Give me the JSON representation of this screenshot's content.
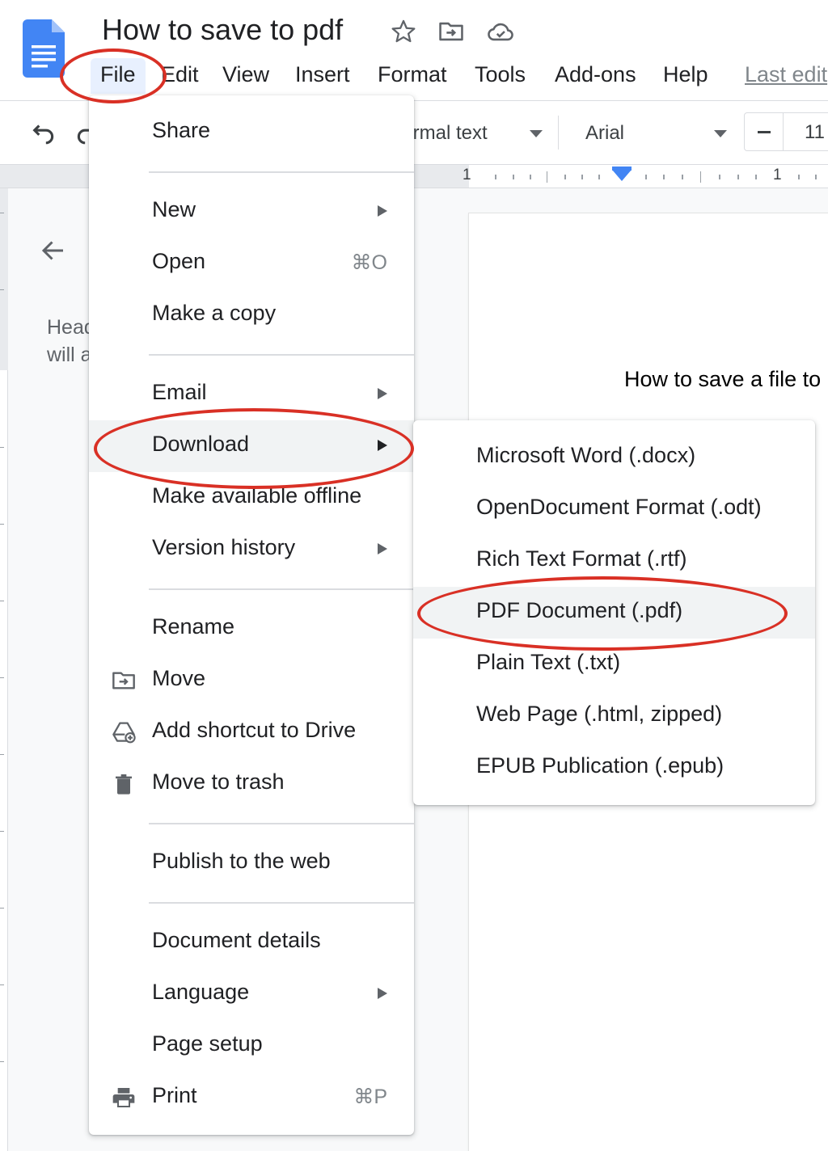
{
  "app": {
    "doc_title": "How to save to pdf",
    "accent": "#4285f4",
    "annotation_color": "#d93025"
  },
  "menubar": {
    "items": [
      "File",
      "Edit",
      "View",
      "Insert",
      "Format",
      "Tools",
      "Add-ons",
      "Help"
    ],
    "last_edit": "Last edit"
  },
  "toolbar": {
    "style": "Normal text",
    "font": "Arial",
    "size": "11"
  },
  "ruler": {
    "left_num": "1",
    "right_num": "1"
  },
  "outline": {
    "line1": "Headings",
    "line2": "will appear"
  },
  "document": {
    "text": "How to save a file to pdf"
  },
  "file_menu": {
    "share": "Share",
    "new": "New",
    "open": "Open",
    "open_shortcut": "⌘O",
    "make_copy": "Make a copy",
    "email": "Email",
    "download": "Download",
    "make_offline": "Make available offline",
    "version_history": "Version history",
    "rename": "Rename",
    "move": "Move",
    "add_shortcut": "Add shortcut to Drive",
    "move_trash": "Move to trash",
    "publish": "Publish to the web",
    "doc_details": "Document details",
    "language": "Language",
    "page_setup": "Page setup",
    "print": "Print",
    "print_shortcut": "⌘P"
  },
  "download_menu": {
    "items": [
      "Microsoft Word (.docx)",
      "OpenDocument Format (.odt)",
      "Rich Text Format (.rtf)",
      "PDF Document (.pdf)",
      "Plain Text (.txt)",
      "Web Page (.html, zipped)",
      "EPUB Publication (.epub)"
    ]
  }
}
